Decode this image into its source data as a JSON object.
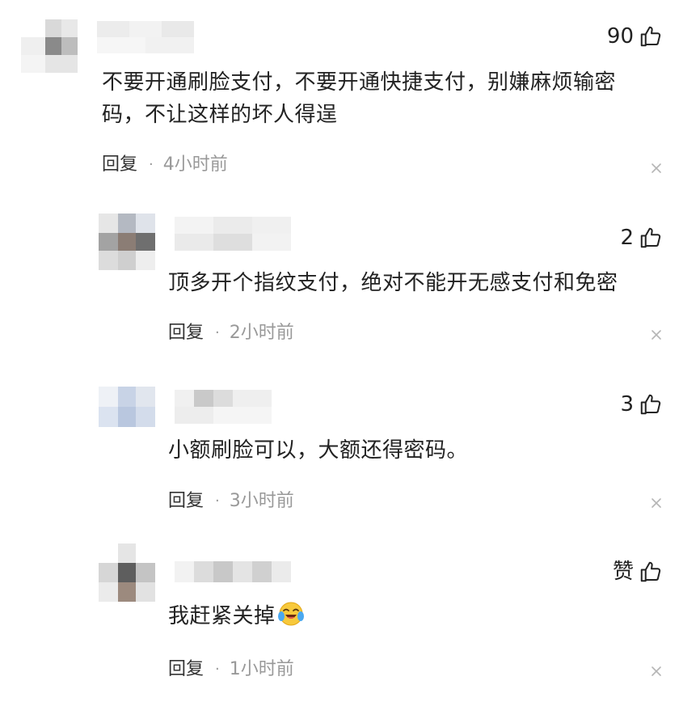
{
  "comments": [
    {
      "likes": "90",
      "text": "不要开通刷脸支付，不要开通快捷支付，别嫌麻烦输密码，不让这样的坏人得逞",
      "text_line1": "不要开通刷脸支付，不要开通快捷支付，别嫌麻烦输密",
      "text_line2": "码，不让这样的坏人得逞",
      "reply_label": "回复",
      "separator": "·",
      "time": "4小时前"
    },
    {
      "likes": "2",
      "text": "顶多开个指纹支付，绝对不能开无感支付和免密",
      "reply_label": "回复",
      "separator": "·",
      "time": "2小时前"
    },
    {
      "likes": "3",
      "text": "小额刷脸可以，大额还得密码。",
      "reply_label": "回复",
      "separator": "·",
      "time": "3小时前"
    },
    {
      "likes": "赞",
      "text": "我赶紧关掉",
      "emoji": "crying-laughing-emoji",
      "reply_label": "回复",
      "separator": "·",
      "time": "1小时前"
    }
  ],
  "icons": {
    "like": "thumbs-up-icon",
    "close": "close-icon"
  },
  "colors": {
    "text": "#222222",
    "muted": "#999999",
    "background": "#ffffff"
  }
}
